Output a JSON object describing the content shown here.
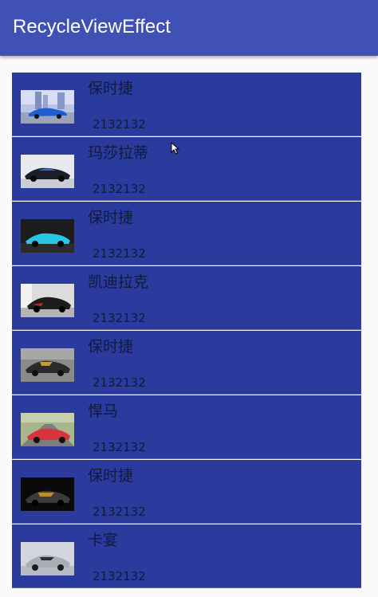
{
  "app_bar": {
    "title": "RecycleViewEffect",
    "color": "#3f51b5"
  },
  "list": {
    "row_color": "#2a3a9d",
    "items": [
      {
        "name": "保时捷",
        "number": "2132132",
        "image": "blue-supercar-city"
      },
      {
        "name": "玛莎拉蒂",
        "number": "2132132",
        "image": "black-concept-car"
      },
      {
        "name": "保时捷",
        "number": "2132132",
        "image": "cyan-sports-car"
      },
      {
        "name": "凯迪拉克",
        "number": "2132132",
        "image": "black-red-supercar"
      },
      {
        "name": "保时捷",
        "number": "2132132",
        "image": "black-gold-supercar"
      },
      {
        "name": "悍马",
        "number": "2132132",
        "image": "red-sports-car-road"
      },
      {
        "name": "保时捷",
        "number": "2132132",
        "image": "black-gold-car-dark"
      },
      {
        "name": "卡宴",
        "number": "2132132",
        "image": "silver-sports-car"
      }
    ]
  },
  "cursor": {
    "icon": "mouse-pointer-icon"
  }
}
